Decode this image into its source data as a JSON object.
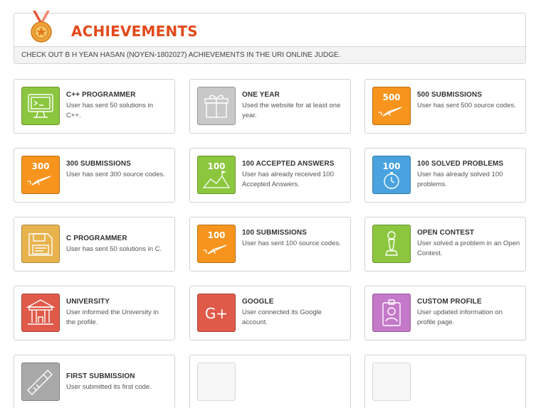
{
  "header": {
    "title": "ACHIEVEMENTS",
    "subtitle": "CHECK OUT B H YEAN HASAN (NOYEN-1802027) ACHIEVEMENTS IN THE URI ONLINE JUDGE."
  },
  "colors": {
    "title": "#e24a1b",
    "green": "#8cc63f",
    "gray": "#c8c8c8",
    "orange": "#f7941d",
    "blue": "#4aa3df",
    "yellow": "#e8b34d",
    "red": "#e05a4a",
    "purple": "#c479c9"
  },
  "achievements": [
    {
      "title": "C++ PROGRAMMER",
      "desc": "User has sent 50 solutions in C++.",
      "icon": "monitor-icon",
      "badge_text": ""
    },
    {
      "title": "ONE YEAR",
      "desc": "Used the website for at least one year.",
      "icon": "gift-icon",
      "badge_text": ""
    },
    {
      "title": "500 SUBMISSIONS",
      "desc": "User has sent 500 source codes.",
      "icon": "paper-plane-icon",
      "badge_text": "500"
    },
    {
      "title": "300 SUBMISSIONS",
      "desc": "User has sent 300 source codes.",
      "icon": "paper-plane-icon",
      "badge_text": "300"
    },
    {
      "title": "100 ACCEPTED ANSWERS",
      "desc": "User has already received 100 Accepted Answers.",
      "icon": "flag-icon",
      "badge_text": "100"
    },
    {
      "title": "100 SOLVED PROBLEMS",
      "desc": "User has already solved 100 problems.",
      "icon": "stopwatch-icon",
      "badge_text": "100"
    },
    {
      "title": "C PROGRAMMER",
      "desc": "User has sent 50 solutions in C.",
      "icon": "floppy-icon",
      "badge_text": ""
    },
    {
      "title": "100 SUBMISSIONS",
      "desc": "User has sent 100 source codes.",
      "icon": "paper-plane-icon",
      "badge_text": "100"
    },
    {
      "title": "OPEN CONTEST",
      "desc": "User solved a problem in an Open Contest.",
      "icon": "chess-pawn-icon",
      "badge_text": ""
    },
    {
      "title": "UNIVERSITY",
      "desc": "User informed the University in the profile.",
      "icon": "university-icon",
      "badge_text": ""
    },
    {
      "title": "GOOGLE",
      "desc": "User connected its Google account.",
      "icon": "google-plus-icon",
      "badge_text": "G+"
    },
    {
      "title": "CUSTOM PROFILE",
      "desc": "User updated information on profile page.",
      "icon": "id-badge-icon",
      "badge_text": ""
    },
    {
      "title": "FIRST SUBMISSION",
      "desc": "User submitted its first code.",
      "icon": "usb-stick-icon",
      "badge_text": ""
    },
    {
      "title": "",
      "desc": "",
      "icon": "empty-badge",
      "badge_text": ""
    },
    {
      "title": "",
      "desc": "",
      "icon": "empty-badge",
      "badge_text": ""
    }
  ]
}
